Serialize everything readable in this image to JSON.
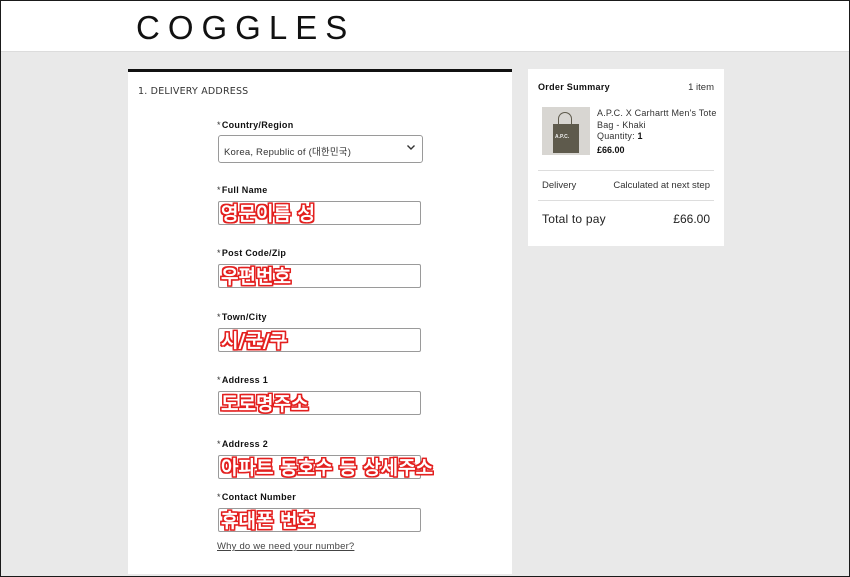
{
  "brand": {
    "logo": "COGGLES"
  },
  "delivery": {
    "section_title": "1. DELIVERY ADDRESS",
    "country": {
      "label": "Country/Region",
      "value": "Korea, Republic of (대한민국)"
    },
    "fields": [
      {
        "label": "Full Name",
        "value": "영문이름 성"
      },
      {
        "label": "Post Code/Zip",
        "value": "우편번호"
      },
      {
        "label": "Town/City",
        "value": "시/군/구"
      },
      {
        "label": "Address 1",
        "value": "도로명주소"
      },
      {
        "label": "Address 2",
        "value": "아파트 동호수 등 상세주소"
      },
      {
        "label": "Contact Number",
        "value": "휴대폰 번호"
      }
    ],
    "required_mark": "*",
    "help_link": "Why do we need your number?"
  },
  "summary": {
    "title": "Order Summary",
    "item_count": "1 item",
    "product": {
      "name": "A.P.C. X Carhartt Men's Tote Bag - Khaki",
      "quantity_label": "Quantity:",
      "quantity": "1",
      "price": "£66.00",
      "thumb_text": "A.P.C."
    },
    "delivery_label": "Delivery",
    "delivery_value": "Calculated at next step",
    "total_label": "Total to pay",
    "total_value": "£66.00"
  },
  "colors": {
    "annotation_red": "#e3201f",
    "page_bg": "#e9e9e9"
  }
}
